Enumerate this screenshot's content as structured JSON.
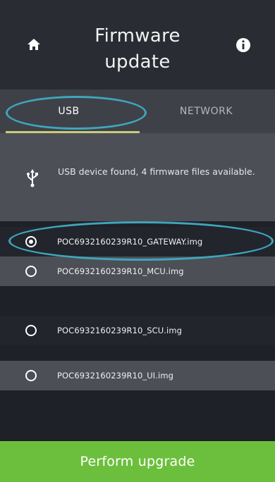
{
  "header": {
    "title_line1": "Firmware",
    "title_line2": "update",
    "home_icon": "home-icon",
    "info_icon": "info-icon"
  },
  "tabs": [
    {
      "label": "USB",
      "active": true
    },
    {
      "label": "NETWORK",
      "active": false
    }
  ],
  "status": {
    "icon": "usb-icon",
    "message": "USB device found, 4 firmware files available."
  },
  "files": [
    {
      "name": "POC6932160239R10_GATEWAY.img",
      "selected": true
    },
    {
      "name": "POC6932160239R10_MCU.img",
      "selected": false
    },
    {
      "name": "POC6932160239R10_SCU.img",
      "selected": false
    },
    {
      "name": "POC6932160239R10_UI.img",
      "selected": false
    }
  ],
  "action": {
    "upgrade_label": "Perform upgrade"
  },
  "colors": {
    "accent_green": "#6cbf3c",
    "highlight_ring": "#3ea6bd",
    "tab_underline": "#c8cc7a"
  }
}
